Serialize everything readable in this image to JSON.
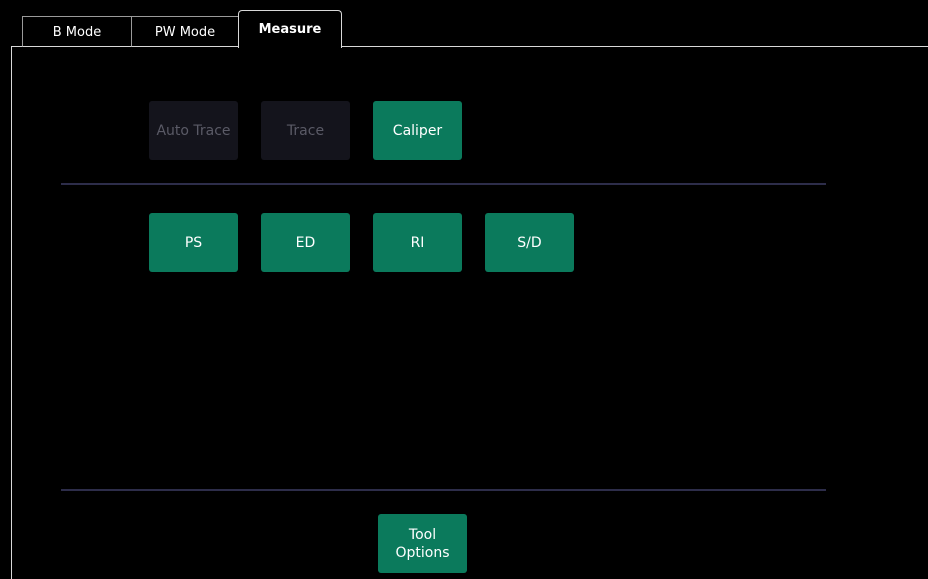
{
  "tabs": [
    {
      "label": "B Mode",
      "active": false
    },
    {
      "label": "PW Mode",
      "active": false
    },
    {
      "label": "Measure",
      "active": true
    }
  ],
  "measure": {
    "tools": [
      {
        "label": "Auto Trace",
        "enabled": false
      },
      {
        "label": "Trace",
        "enabled": false
      },
      {
        "label": "Caliper",
        "enabled": true
      }
    ],
    "measurements": [
      {
        "label": "PS"
      },
      {
        "label": "ED"
      },
      {
        "label": "RI"
      },
      {
        "label": "S/D"
      }
    ],
    "tool_options_label": "Tool\nOptions"
  },
  "colors": {
    "background": "#000000",
    "button_enabled": "#0b7a5c",
    "button_disabled": "#14141c",
    "text_disabled": "#5a5a66",
    "divider": "#2d2d4a"
  }
}
